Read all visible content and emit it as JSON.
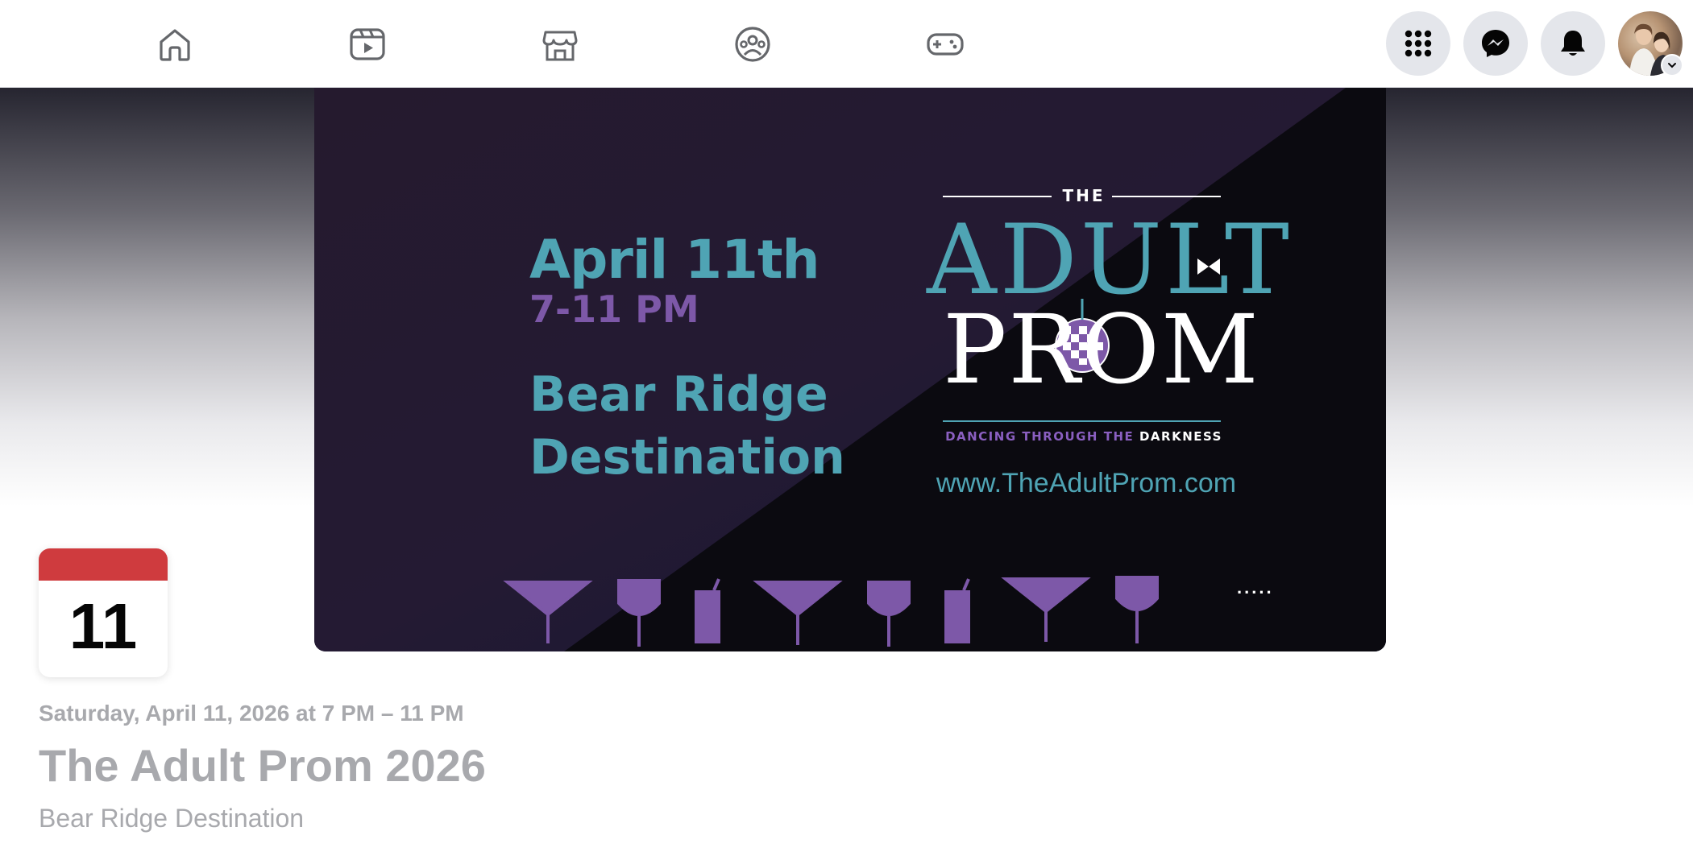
{
  "nav": {
    "tabs": [
      {
        "name": "home-icon"
      },
      {
        "name": "video-icon"
      },
      {
        "name": "marketplace-icon"
      },
      {
        "name": "groups-icon"
      },
      {
        "name": "gaming-icon"
      }
    ],
    "right": [
      {
        "name": "menu-grid-icon"
      },
      {
        "name": "messenger-icon"
      },
      {
        "name": "notifications-bell-icon"
      }
    ]
  },
  "cover": {
    "date": "April 11th",
    "time": "7-11 PM",
    "venue": "Bear Ridge Destination",
    "logo_the": "THE",
    "logo_adult": "ADULT",
    "logo_prom": "PROM",
    "tagline_a": "DANCING THROUGH THE ",
    "tagline_b": "DARKNESS",
    "url": "www.TheAdultProm.com",
    "dots": ".....",
    "colors": {
      "teal": "#4fa4b4",
      "purple": "#7d58a8"
    }
  },
  "event": {
    "calendar_day": "11",
    "when": "Saturday, April 11, 2026 at 7 PM – 11 PM",
    "title": "The Adult Prom 2026",
    "location": "Bear Ridge Destination"
  },
  "colors": {
    "calendar_header": "#cf3b3e",
    "muted_text": "#a8a9ad"
  }
}
